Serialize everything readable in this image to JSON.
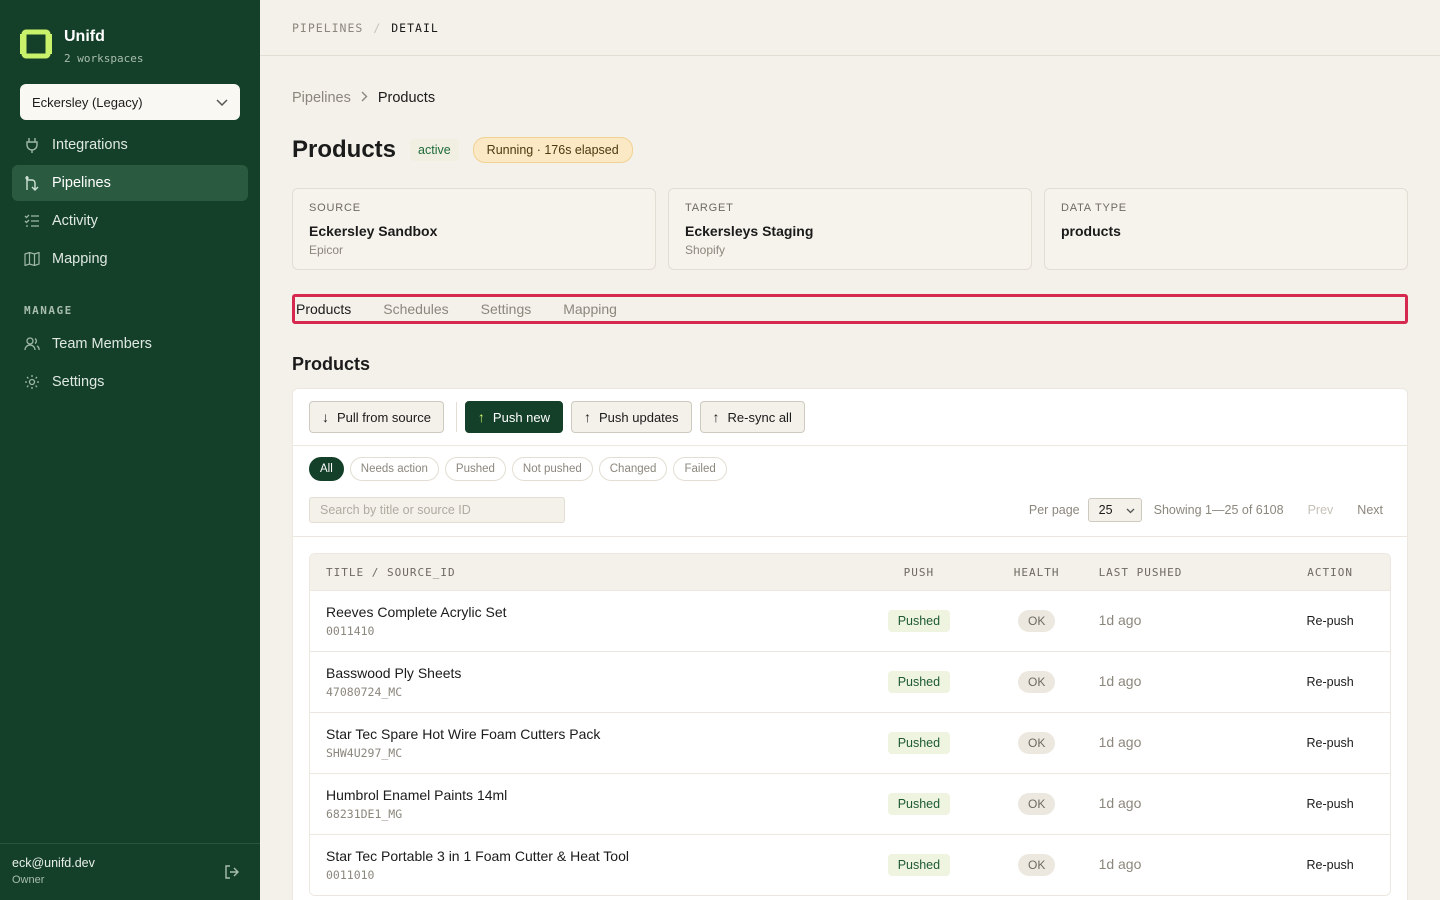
{
  "brand": {
    "name": "Unifd",
    "subtitle": "2 workspaces"
  },
  "workspace": {
    "selected": "Eckersley (Legacy)"
  },
  "sidebar": {
    "items": [
      {
        "label": "Integrations",
        "icon": "plug-icon"
      },
      {
        "label": "Pipelines",
        "icon": "pipeline-icon",
        "active": true
      },
      {
        "label": "Activity",
        "icon": "list-check-icon"
      },
      {
        "label": "Mapping",
        "icon": "map-icon"
      }
    ],
    "manage_label": "MANAGE",
    "manage_items": [
      {
        "label": "Team Members",
        "icon": "users-icon"
      },
      {
        "label": "Settings",
        "icon": "gear-icon"
      }
    ],
    "user": {
      "email": "eck@unifd.dev",
      "role": "Owner"
    }
  },
  "topbar": {
    "crumb1": "PIPELINES",
    "sep": "/",
    "crumb2": "DETAIL"
  },
  "breadcrumb": {
    "parent": "Pipelines",
    "current": "Products"
  },
  "header": {
    "title": "Products",
    "status": "active",
    "running": "Running · 176s elapsed"
  },
  "cards": [
    {
      "label": "SOURCE",
      "value": "Eckersley Sandbox",
      "sub": "Epicor"
    },
    {
      "label": "TARGET",
      "value": "Eckersleys Staging",
      "sub": "Shopify"
    },
    {
      "label": "DATA TYPE",
      "value": "products",
      "sub": ""
    }
  ],
  "tabs": [
    "Products",
    "Schedules",
    "Settings",
    "Mapping"
  ],
  "section_title": "Products",
  "toolbar": {
    "pull": "Pull from source",
    "push_new": "Push new",
    "push_updates": "Push updates",
    "resync": "Re-sync all"
  },
  "filters": [
    "All",
    "Needs action",
    "Pushed",
    "Not pushed",
    "Changed",
    "Failed"
  ],
  "search": {
    "placeholder": "Search by title or source ID"
  },
  "pager": {
    "per_page_label": "Per page",
    "per_page": "25",
    "showing": "Showing 1—25 of 6108",
    "prev": "Prev",
    "next": "Next"
  },
  "table": {
    "headers": {
      "title": "TITLE / SOURCE_ID",
      "push": "PUSH",
      "health": "HEALTH",
      "last": "LAST PUSHED",
      "action": "ACTION"
    },
    "rows": [
      {
        "title": "Reeves Complete Acrylic Set",
        "sid": "0011410",
        "push": "Pushed",
        "health": "OK",
        "last": "1d ago",
        "action": "Re-push"
      },
      {
        "title": "Basswood Ply Sheets",
        "sid": "47080724_MC",
        "push": "Pushed",
        "health": "OK",
        "last": "1d ago",
        "action": "Re-push"
      },
      {
        "title": "Star Tec Spare Hot Wire Foam Cutters Pack",
        "sid": "SHW4U297_MC",
        "push": "Pushed",
        "health": "OK",
        "last": "1d ago",
        "action": "Re-push"
      },
      {
        "title": "Humbrol Enamel Paints 14ml",
        "sid": "68231DE1_MG",
        "push": "Pushed",
        "health": "OK",
        "last": "1d ago",
        "action": "Re-push"
      },
      {
        "title": "Star Tec Portable 3 in 1 Foam Cutter & Heat Tool",
        "sid": "0011010",
        "push": "Pushed",
        "health": "OK",
        "last": "1d ago",
        "action": "Re-push"
      }
    ]
  },
  "colors": {
    "sidebar": "#14402a",
    "accent": "#c9f26a",
    "tab_highlight": "#d6294f"
  }
}
